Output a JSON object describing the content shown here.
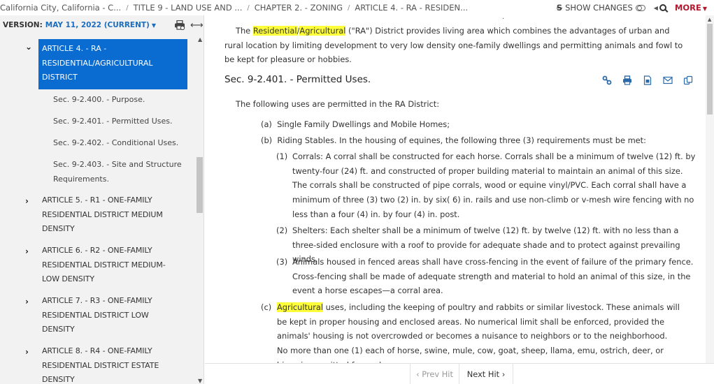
{
  "breadcrumb": [
    "California City, California - C...",
    "TITLE 9 - LAND USE AND ...",
    "CHAPTER 2. - ZONING",
    "ARTICLE 4. - RA - RESIDEN..."
  ],
  "breadcrumb_separator": "/",
  "top_actions": {
    "show_changes_label": "SHOW CHANGES",
    "more_label": "MORE"
  },
  "sidebar": {
    "version_label": "VERSION:",
    "version_value": "MAY 11, 2022 (CURRENT)",
    "active_article": {
      "chevron": "expanded",
      "lines": [
        "ARTICLE 4. - RA -",
        "RESIDENTIAL/AGRICULTURAL",
        "DISTRICT"
      ]
    },
    "sections": [
      [
        "Sec. 9-2.400. - Purpose."
      ],
      [
        "Sec. 9-2.401. - Permitted Uses."
      ],
      [
        "Sec. 9-2.402. - Conditional Uses."
      ],
      [
        "Sec. 9-2.403. - Site and Structure",
        "Requirements."
      ]
    ],
    "articles": [
      {
        "lines": [
          "ARTICLE 5. - R1 - ONE-FAMILY",
          "RESIDENTIAL DISTRICT MEDIUM",
          "DENSITY"
        ]
      },
      {
        "lines": [
          "ARTICLE 6. - R2 - ONE-FAMILY",
          "RESIDENTIAL DISTRICT MEDIUM-",
          "LOW DENSITY"
        ]
      },
      {
        "lines": [
          "ARTICLE 7. - R3 - ONE-FAMILY",
          "RESIDENTIAL DISTRICT LOW",
          "DENSITY"
        ]
      },
      {
        "lines": [
          "ARTICLE 8. - R4 - ONE-FAMILY",
          "RESIDENTIAL DISTRICT ESTATE",
          "DENSITY"
        ]
      }
    ]
  },
  "content": {
    "intro": {
      "pre": "The ",
      "hl1": "Residential",
      "slash": "/",
      "hl2": "Agricultural",
      "rest": " (\"RA\") District provides living area which combines the advantages of urban and rural location by limiting development to very low density one-family dwellings and permitting animals and fowl to be kept for pleasure or hobbies."
    },
    "section_title": "Sec. 9-2.401. - Permitted Uses.",
    "section_tools": [
      "link-icon",
      "print-icon",
      "download-doc-icon",
      "email-icon",
      "compare-icon"
    ],
    "lead": "The following uses are permitted in the RA District:",
    "item_a": {
      "label": "(a)",
      "text": "Single Family Dwellings and Mobile Homes;"
    },
    "item_b": {
      "label": "(b)",
      "text": "Riding Stables. In the housing of equines, the following three (3) requirements must be met:"
    },
    "sub_items": [
      {
        "label": "(1)",
        "text": "Corrals: A corral shall be constructed for each horse. Corrals shall be a minimum of twelve (12) ft. by twenty-four (24) ft. and constructed of proper building material to maintain an animal of this size. The corrals shall be constructed of pipe corrals, wood or equine vinyl/PVC. Each corral shall have a minimum of three (3) two (2) in. by six( 6) in. rails and use non-climb or v-mesh wire fencing with no less than a four (4) in. by four (4) in. post."
      },
      {
        "label": "(2)",
        "text": "Shelters: Each shelter shall be a minimum of twelve (12) ft. by twelve (12) ft. with no less than a three-sided enclosure with a roof to provide for adequate shade and to protect against prevailing winds."
      },
      {
        "label": "(3)",
        "text": "Animals housed in fenced areas shall have cross-fencing in the event of failure of the primary fence. Cross-fencing shall be made of adequate strength and material to hold an animal of this size, in the event a horse escapes—a corral area."
      }
    ],
    "item_c": {
      "label": "(c)",
      "hl": "Agricultural",
      "text": " uses, including the keeping of poultry and rabbits or similar livestock. These animals will be kept in proper housing and enclosed areas. No numerical limit shall be enforced, provided the animals' housing is not overcrowded or becomes a nuisance to neighbors or to the neighborhood. No more than one (1) each of horse, swine, mule, cow, goat, sheep, llama, emu, ostrich, deer, or bison is permitted for each"
    }
  },
  "hit_nav": {
    "prev_label": "‹ Prev Hit",
    "next_label": "Next Hit ›"
  },
  "colors": {
    "active_bg": "#0a6bd0",
    "highlight": "#ffff3a",
    "more": "#b5172f",
    "link": "#1b6dbf"
  }
}
